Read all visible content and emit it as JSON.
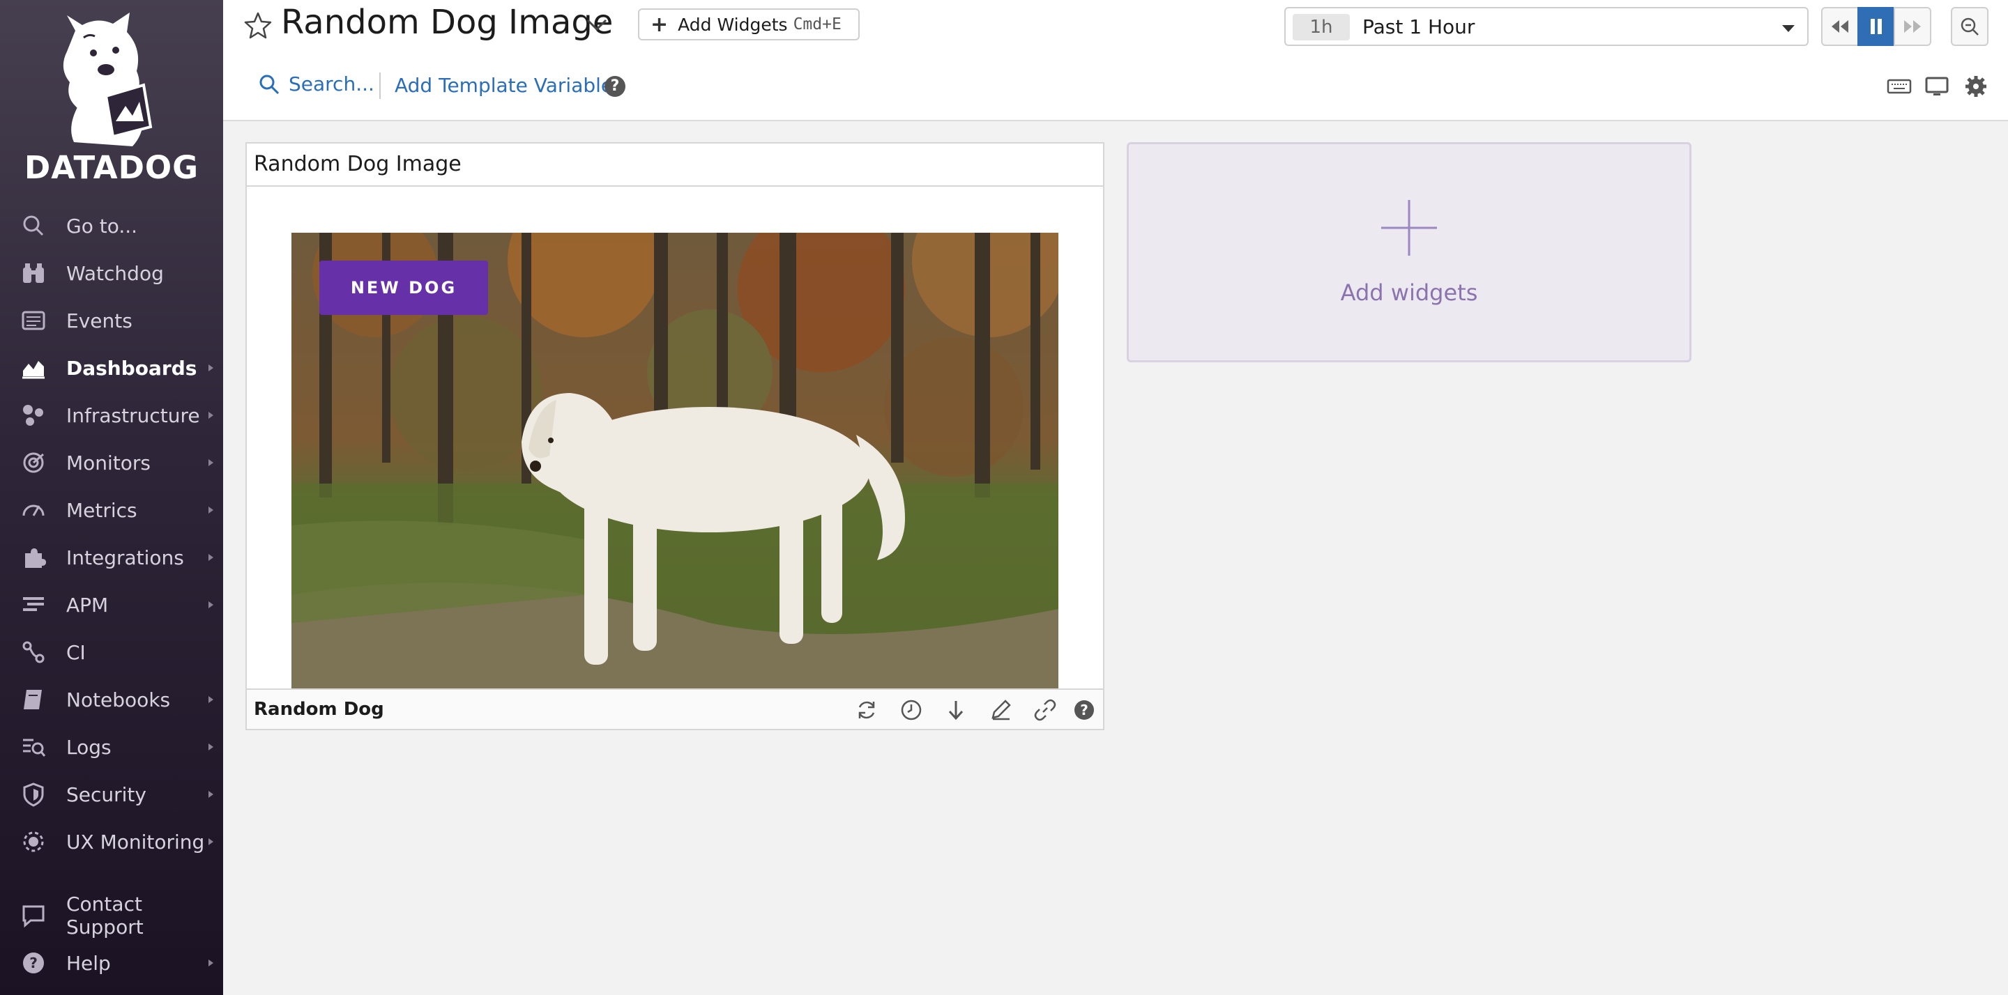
{
  "sidebar": {
    "brand": "DATADOG",
    "items": [
      {
        "label": "Go to...",
        "icon": "search-icon",
        "has_submenu": false
      },
      {
        "label": "Watchdog",
        "icon": "binoculars-icon",
        "has_submenu": false
      },
      {
        "label": "Events",
        "icon": "events-icon",
        "has_submenu": false
      },
      {
        "label": "Dashboards",
        "icon": "dashboards-icon",
        "has_submenu": true,
        "active": true
      },
      {
        "label": "Infrastructure",
        "icon": "infrastructure-icon",
        "has_submenu": true
      },
      {
        "label": "Monitors",
        "icon": "monitors-icon",
        "has_submenu": true
      },
      {
        "label": "Metrics",
        "icon": "metrics-icon",
        "has_submenu": true
      },
      {
        "label": "Integrations",
        "icon": "puzzle-icon",
        "has_submenu": true
      },
      {
        "label": "APM",
        "icon": "apm-icon",
        "has_submenu": true
      },
      {
        "label": "CI",
        "icon": "ci-icon",
        "has_submenu": false
      },
      {
        "label": "Notebooks",
        "icon": "notebook-icon",
        "has_submenu": true
      },
      {
        "label": "Logs",
        "icon": "logs-icon",
        "has_submenu": true
      },
      {
        "label": "Security",
        "icon": "shield-icon",
        "has_submenu": true
      },
      {
        "label": "UX Monitoring",
        "icon": "ux-monitoring-icon",
        "has_submenu": true
      }
    ],
    "bottom_items": [
      {
        "label": "Contact Support",
        "icon": "chat-icon",
        "has_submenu": false
      },
      {
        "label": "Help",
        "icon": "help-icon",
        "has_submenu": true
      }
    ]
  },
  "header": {
    "title": "Random Dog Image",
    "add_widgets_label": "Add Widgets",
    "add_widgets_shortcut": "Cmd+E",
    "search_placeholder": "Search...",
    "template_variables_label": "Add Template Variables",
    "help_glyph": "?",
    "time": {
      "chip": "1h",
      "value": "Past 1 Hour"
    }
  },
  "widgets": {
    "image_widget": {
      "title": "Random Dog Image",
      "button_label": "NEW DOG",
      "footer_title": "Random Dog"
    },
    "add_card": {
      "label": "Add widgets"
    }
  },
  "colors": {
    "accent": "#632ca6",
    "link": "#2a6ebb",
    "active_control": "#2f6db5"
  }
}
